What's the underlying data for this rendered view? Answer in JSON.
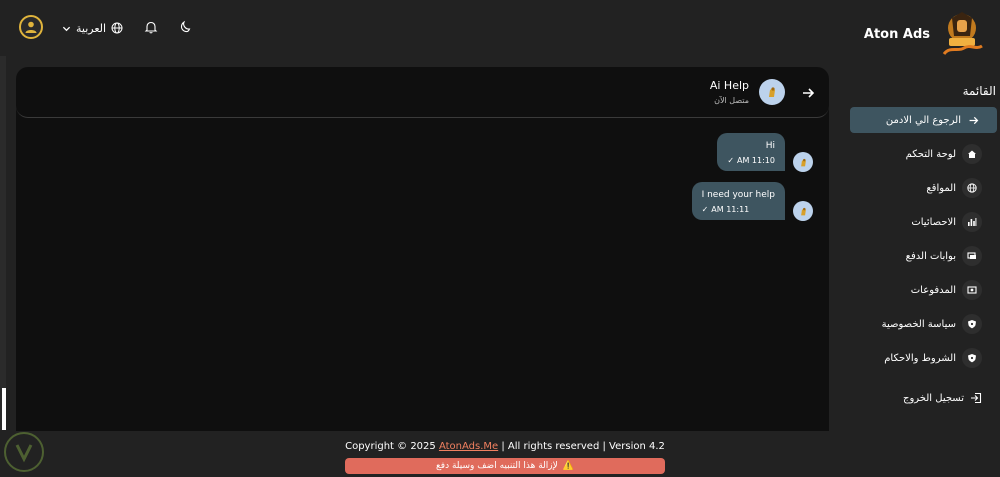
{
  "topbar": {
    "language_label": "العربية",
    "brand_name": "Aton Ads",
    "logo_text": "AtonAds"
  },
  "chat": {
    "title": "Ai Help",
    "status": "متصل الآن",
    "messages": [
      {
        "text": "Hi",
        "time": "AM 11:10",
        "check": "✓"
      },
      {
        "text": "I need your help",
        "time": "AM 11:11",
        "check": "✓"
      }
    ]
  },
  "sidebar": {
    "heading": "القائمة",
    "back_admin": "الرجوع الي الادمن",
    "items": [
      {
        "label": "لوحة التحكم",
        "icon": "home-icon"
      },
      {
        "label": "المواقع",
        "icon": "globe-icon"
      },
      {
        "label": "الاحصائيات",
        "icon": "bar-chart-icon"
      },
      {
        "label": "بوابات الدفع",
        "icon": "payment-gateway-icon"
      },
      {
        "label": "المدفوعات",
        "icon": "payments-icon"
      },
      {
        "label": "سياسة الخصوصية",
        "icon": "shield-icon"
      },
      {
        "label": "الشروط والاحكام",
        "icon": "shield-icon"
      }
    ],
    "logout": "تسجيل الخروج"
  },
  "footer": {
    "copyright_prefix": "Copyright © 2025 ",
    "link_text": "AtonAds.Me",
    "copyright_suffix": " | All rights reserved | Version 4.2",
    "notice": "لإزالة هذا التنبيه اضف وسيلة دفع",
    "notice_icon": "⚠️"
  },
  "colors": {
    "background": "#222222",
    "chat_background": "#0f0f0f",
    "accent": "#3e5560",
    "notice": "#e06b5c",
    "avatar_ring": "#e0b43c"
  }
}
